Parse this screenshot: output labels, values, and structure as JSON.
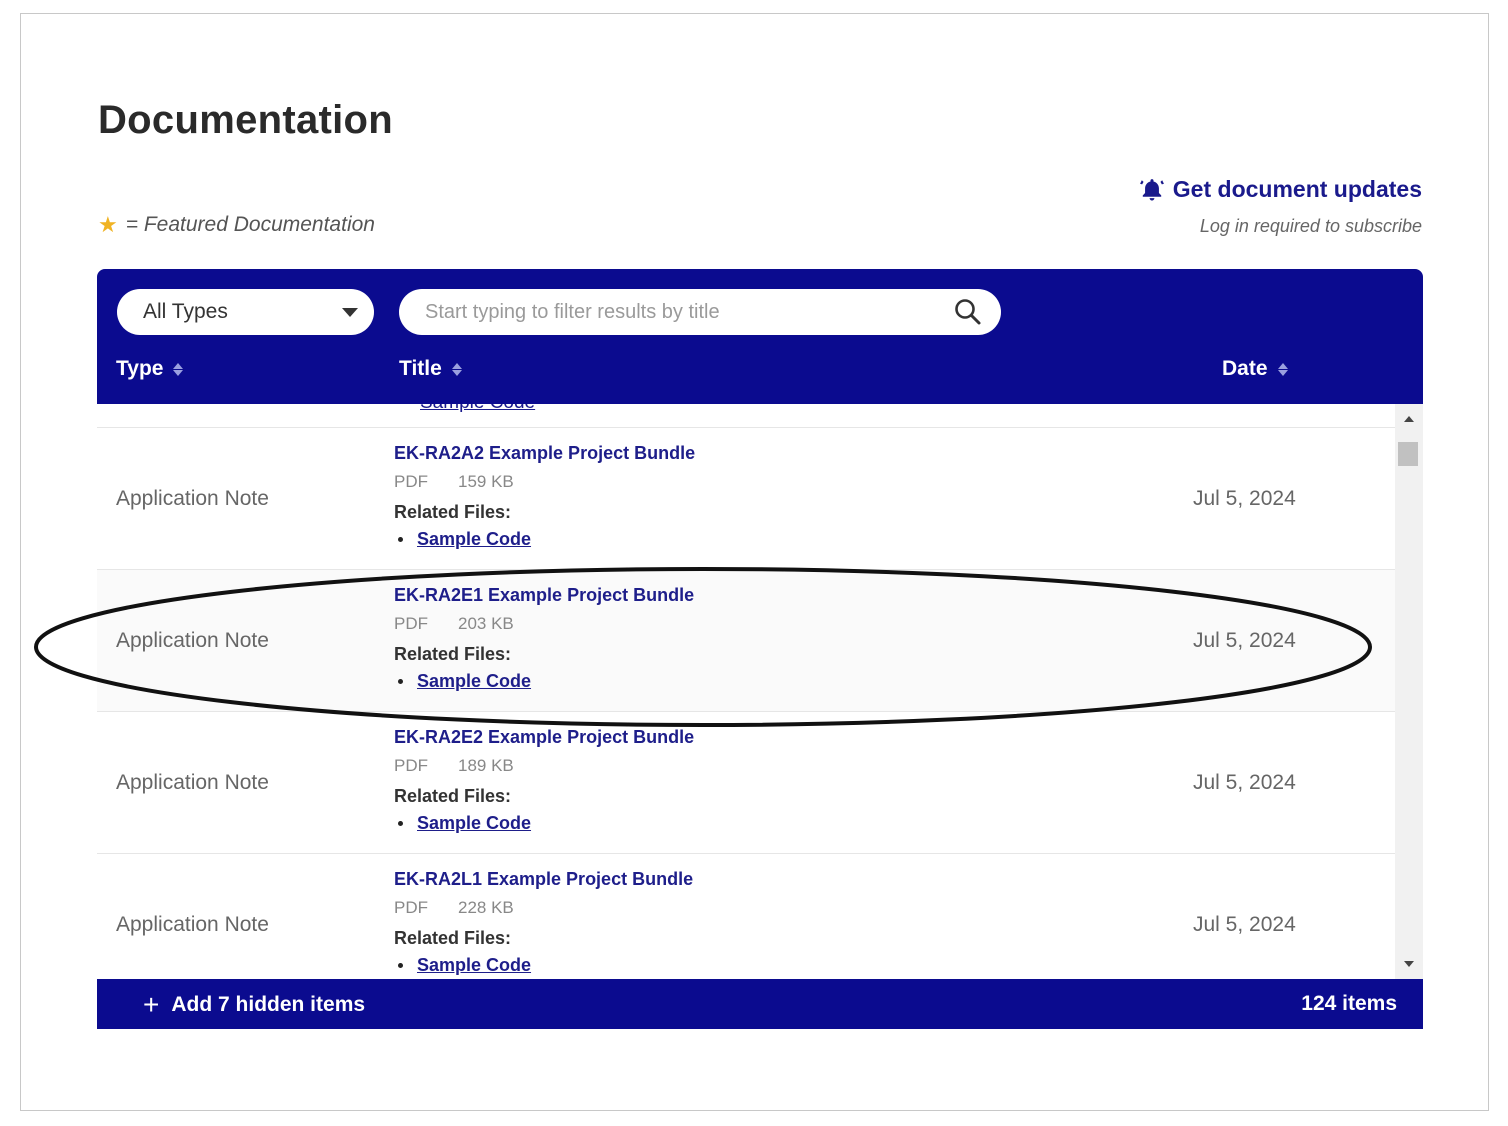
{
  "page": {
    "title": "Documentation"
  },
  "legend": {
    "icon": "star-icon",
    "text": "= Featured Documentation"
  },
  "updates": {
    "link_label": "Get document updates",
    "note": "Log in required to subscribe",
    "icon": "bell-icon"
  },
  "filters": {
    "type_select": {
      "value": "All Types",
      "icon": "caret-down-icon"
    },
    "search": {
      "placeholder": "Start typing to filter results by title",
      "value": "",
      "icon": "search-icon"
    }
  },
  "columns": {
    "type": "Type",
    "title": "Title",
    "date": "Date"
  },
  "partial_row": {
    "link": "Sample Code"
  },
  "rows": [
    {
      "type": "Application Note",
      "title": "EK-RA2A2 Example Project Bundle",
      "format": "PDF",
      "size": "159 KB",
      "related_label": "Related Files:",
      "related": "Sample Code",
      "date": "Jul 5, 2024"
    },
    {
      "type": "Application Note",
      "title": "EK-RA2E1 Example Project Bundle",
      "format": "PDF",
      "size": "203 KB",
      "related_label": "Related Files:",
      "related": "Sample Code",
      "date": "Jul 5, 2024"
    },
    {
      "type": "Application Note",
      "title": "EK-RA2E2 Example Project Bundle",
      "format": "PDF",
      "size": "189 KB",
      "related_label": "Related Files:",
      "related": "Sample Code",
      "date": "Jul 5, 2024"
    },
    {
      "type": "Application Note",
      "title": "EK-RA2L1 Example Project Bundle",
      "format": "PDF",
      "size": "228 KB",
      "related_label": "Related Files:",
      "related": "Sample Code",
      "date": "Jul 5, 2024"
    }
  ],
  "footer": {
    "add_hidden": "Add 7 hidden items",
    "count": "124 items"
  },
  "colors": {
    "header_bg": "#0b0b8f",
    "link": "#1e1e8a",
    "star": "#f0b323"
  }
}
